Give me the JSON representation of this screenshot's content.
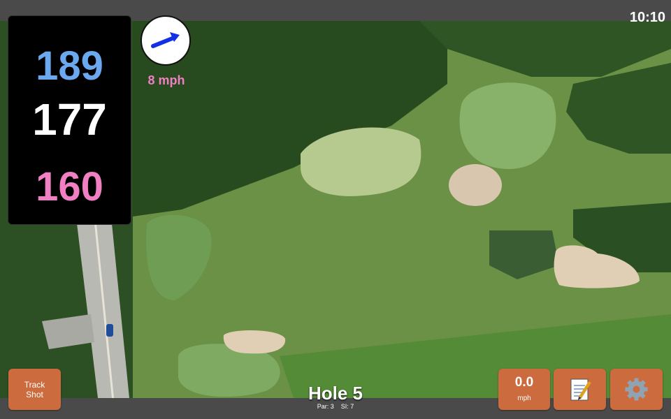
{
  "status": {
    "time": "10:10"
  },
  "distances": {
    "back": "189",
    "middle": "177",
    "front": "160"
  },
  "wind": {
    "speed_label": "8 mph",
    "direction_icon": "wind-direction-arrow-icon"
  },
  "buttons": {
    "track_line1": "Track",
    "track_line2": "Shot",
    "speed_value": "0.0",
    "speed_unit": "mph",
    "notes_icon": "notepad-icon",
    "settings_icon": "gear-icon"
  },
  "hole": {
    "title": "Hole 5",
    "par": "Par: 3",
    "si": "SI: 7"
  },
  "colors": {
    "back": "#6aa9f0",
    "middle": "#ffffff",
    "front": "#f07fc3",
    "button": "#cc6b3d"
  }
}
